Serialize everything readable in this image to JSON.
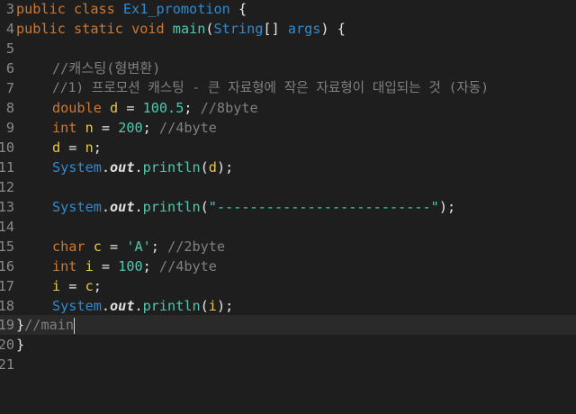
{
  "editor": {
    "lines": {
      "l3": {
        "num": "3",
        "kw1": "public",
        "kw2": "class",
        "cls": "Ex1_promotion",
        "brace": "{"
      },
      "l4": {
        "num": "4",
        "kw1": "public",
        "kw2": "static",
        "kw3": "void",
        "mth": "main",
        "p1": "(",
        "type": "String",
        "p2": "[] ",
        "var": "args",
        "p3": ") {"
      },
      "l5": {
        "num": "5"
      },
      "l6": {
        "num": "6",
        "cmt": "//캐스팅(형변환)"
      },
      "l7": {
        "num": "7",
        "cmt": "//1) 프로모션 캐스팅 - 큰 자료형에 작은 자료형이 대입되는 것 (자동)"
      },
      "l8": {
        "num": "8",
        "type": "double",
        "var": "d",
        "eq": " = ",
        "val": "100.5",
        "semi": "; ",
        "cmt": "//8byte"
      },
      "l9": {
        "num": "9",
        "type": "int",
        "var": "n",
        "eq": " = ",
        "val": "200",
        "semi": "; ",
        "cmt": "//4byte"
      },
      "l10": {
        "num": "10",
        "var": "d",
        "eq": " = ",
        "var2": "n",
        "semi": ";"
      },
      "l11": {
        "num": "11",
        "sys": "System",
        "dot1": ".",
        "out": "out",
        "dot2": ".",
        "mth": "println",
        "p1": "(",
        "arg": "d",
        "p2": ");"
      },
      "l12": {
        "num": "12"
      },
      "l13": {
        "num": "13",
        "sys": "System",
        "dot1": ".",
        "out": "out",
        "dot2": ".",
        "mth": "println",
        "p1": "(",
        "str": "\"--------------------------\"",
        "p2": ");"
      },
      "l14": {
        "num": "14"
      },
      "l15": {
        "num": "15",
        "type": "char",
        "var": "c",
        "eq": " = ",
        "val": "'A'",
        "semi": "; ",
        "cmt": "//2byte"
      },
      "l16": {
        "num": "16",
        "type": "int",
        "var": "i",
        "eq": " = ",
        "val": "100",
        "semi": "; ",
        "cmt": "//4byte"
      },
      "l17": {
        "num": "17",
        "var": "i",
        "eq": " = ",
        "var2": "c",
        "semi": ";"
      },
      "l18": {
        "num": "18",
        "sys": "System",
        "dot1": ".",
        "out": "out",
        "dot2": ".",
        "mth": "println",
        "p1": "(",
        "arg": "i",
        "p2": ");"
      },
      "l19": {
        "num": "19",
        "brace": "}",
        "cmt": "//main"
      },
      "l20": {
        "num": "20",
        "brace": "}"
      },
      "l21": {
        "num": "21"
      }
    }
  }
}
